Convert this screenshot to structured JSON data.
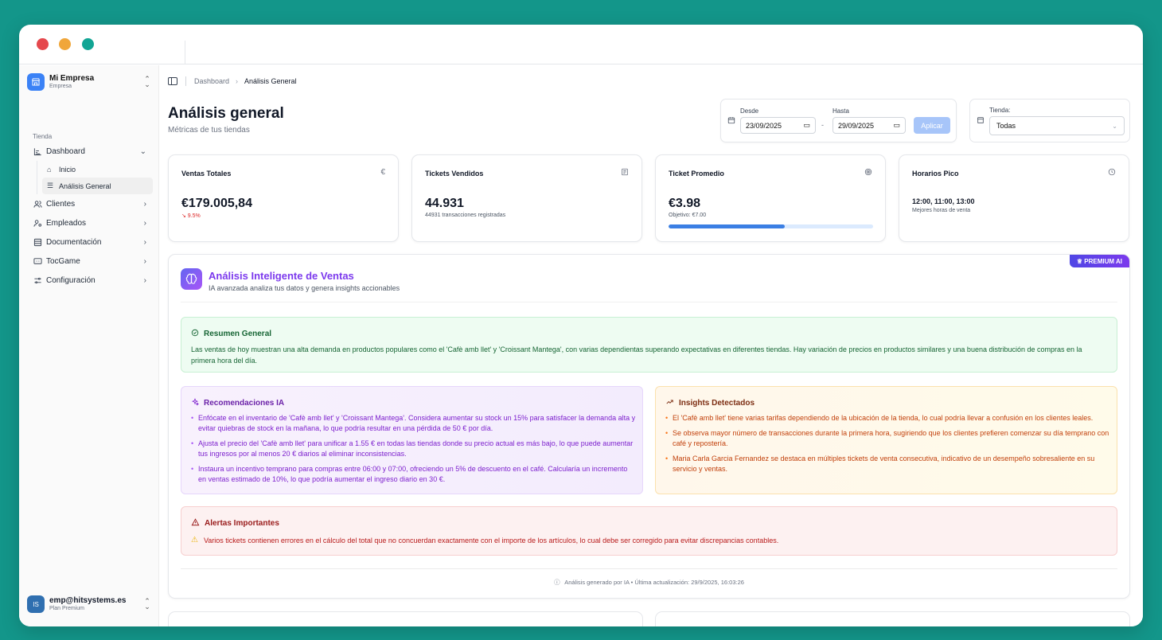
{
  "sidebar": {
    "company_name": "Mi Empresa",
    "company_sub": "Empresa",
    "section_label": "Tienda",
    "nav": {
      "dashboard": "Dashboard",
      "inicio": "Inicio",
      "analisis": "Análisis General",
      "clientes": "Clientes",
      "empleados": "Empleados",
      "documentacion": "Documentación",
      "tocgame": "TocGame",
      "configuracion": "Configuración"
    },
    "user_initials": "IS",
    "user_email": "emp@hitsystems.es",
    "user_plan": "Plan Premium"
  },
  "breadcrumb": {
    "parent": "Dashboard",
    "current": "Análisis General"
  },
  "page": {
    "title": "Análisis general",
    "subtitle": "Métricas de tus tiendas"
  },
  "filters": {
    "from_label": "Desde",
    "from_value": "23/09/2025",
    "to_label": "Hasta",
    "to_value": "29/09/2025",
    "separator": "-",
    "apply_label": "Aplicar",
    "store_label": "Tienda:",
    "store_value": "Todas"
  },
  "kpis": {
    "ventas": {
      "title": "Ventas Totales",
      "icon": "€",
      "value": "€179.005,84",
      "sub": "↘ 9.5%"
    },
    "tickets": {
      "title": "Tickets Vendidos",
      "value": "44.931",
      "sub": "44931 transacciones registradas"
    },
    "promedio": {
      "title": "Ticket Promedio",
      "value": "€3.98",
      "sub": "Objetivo: €7.00",
      "progress": 0.57
    },
    "horarios": {
      "title": "Horarios Pico",
      "value": "12:00, 11:00, 13:00",
      "sub": "Mejores horas de venta"
    }
  },
  "ai": {
    "badge": "♕ PREMIUM AI",
    "title": "Análisis Inteligente de Ventas",
    "subtitle": "IA avanzada analiza tus datos y genera insights accionables",
    "summary_title": "Resumen General",
    "summary_text": "Las ventas de hoy muestran una alta demanda en productos populares como el 'Cafè amb llet' y 'Croissant Mantega', con varias dependientas superando expectativas en diferentes tiendas. Hay variación de precios en productos similares y una buena distribución de compras en la primera hora del día.",
    "reco_title": "Recomendaciones IA",
    "recommendations": [
      "Enfócate en el inventario de 'Cafè amb llet' y 'Croissant Mantega'. Considera aumentar su stock un 15% para satisfacer la demanda alta y evitar quiebras de stock en la mañana, lo que podría resultar en una pérdida de 50 € por día.",
      "Ajusta el precio del 'Cafè amb llet' para unificar a 1.55 € en todas las tiendas donde su precio actual es más bajo, lo que puede aumentar tus ingresos por al menos 20 € diarios al eliminar inconsistencias.",
      "Instaura un incentivo temprano para compras entre 06:00 y 07:00, ofreciendo un 5% de descuento en el café. Calcularía un incremento en ventas estimado de 10%, lo que podría aumentar el ingreso diario en 30 €."
    ],
    "insights_title": "Insights Detectados",
    "insights": [
      "El 'Cafè amb llet' tiene varias tarifas dependiendo de la ubicación de la tienda, lo cual podría llevar a confusión en los clientes leales.",
      "Se observa mayor número de transacciones durante la primera hora, sugiriendo que los clientes prefieren comenzar su día temprano con café y repostería.",
      "Maria Carla Garcia Fernandez se destaca en múltiples tickets de venta consecutiva, indicativo de un desempeño sobresaliente en su servicio y ventas."
    ],
    "alerts_title": "Alertas Importantes",
    "alert_text": "Varios tickets contienen errores en el cálculo del total que no concuerdan exactamente con el importe de los artículos, lo cual debe ser corregido para evitar discrepancias contables.",
    "footer": "Análisis generado por IA • Última actualización: 29/9/2025, 16:03:26"
  }
}
